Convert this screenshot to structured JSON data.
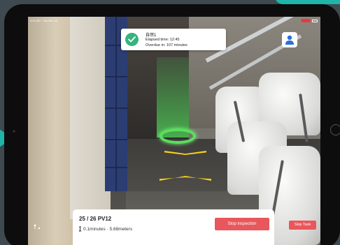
{
  "colors": {
    "accent_teal": "#1fb5a8",
    "stop_red": "#e8575b",
    "success_green": "#36b37e",
    "beacon_green": "#59e05e",
    "arrow_yellow": "#f3d21c"
  },
  "status_bar": {
    "time": "9:41 AM · Thu Dec 19"
  },
  "notification": {
    "icon": "check-circle-icon",
    "title": "自然1",
    "elapsed": "Elapsed time: 12:45",
    "overdue": "Overdue in: 107 minutes"
  },
  "user_button": {
    "icon": "user-icon"
  },
  "task_panel": {
    "title": "25 / 26   PV12",
    "subtitle": "0.1minutes · 5.68meters",
    "walk_icon": "person-walking-icon",
    "stop_label": "Stop inspection"
  },
  "skip_label": "Skip Task",
  "compass_icon": "compass-arrow-icon"
}
